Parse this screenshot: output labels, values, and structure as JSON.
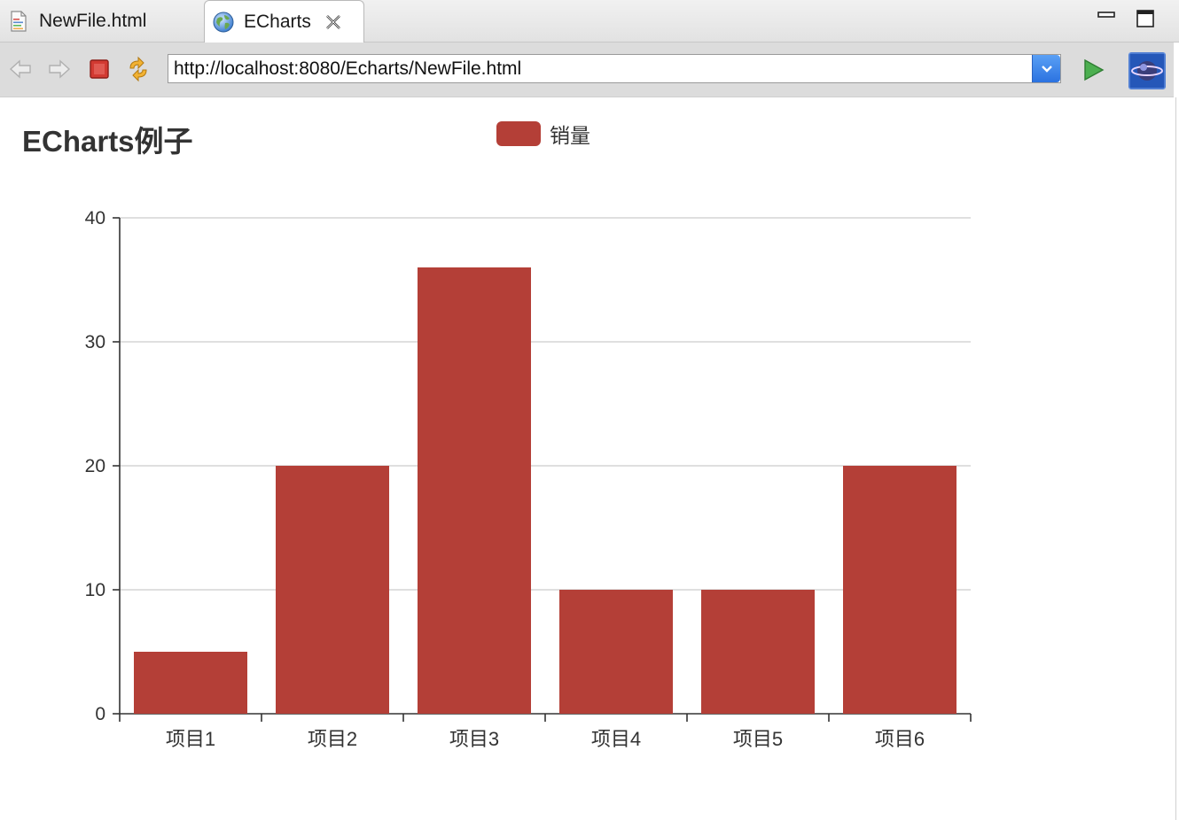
{
  "tabs": [
    {
      "label": "NewFile.html",
      "icon": "html-file-icon",
      "active": false
    },
    {
      "label": "ECharts",
      "icon": "globe-icon",
      "active": true
    }
  ],
  "toolbar": {
    "url": "http://localhost:8080/Echarts/NewFile.html"
  },
  "colors": {
    "bar": "#b43f37",
    "axis": "#333333",
    "grid": "#cccccc"
  },
  "chart_data": {
    "type": "bar",
    "title": "ECharts例子",
    "legend": [
      "销量"
    ],
    "legend_position": "top-center",
    "categories": [
      "项目1",
      "项目2",
      "项目3",
      "项目4",
      "项目5",
      "项目6"
    ],
    "series": [
      {
        "name": "销量",
        "values": [
          5,
          20,
          36,
          10,
          10,
          20
        ]
      }
    ],
    "yticks": [
      0,
      10,
      20,
      30,
      40
    ],
    "ylim": [
      0,
      40
    ],
    "grid": true
  }
}
